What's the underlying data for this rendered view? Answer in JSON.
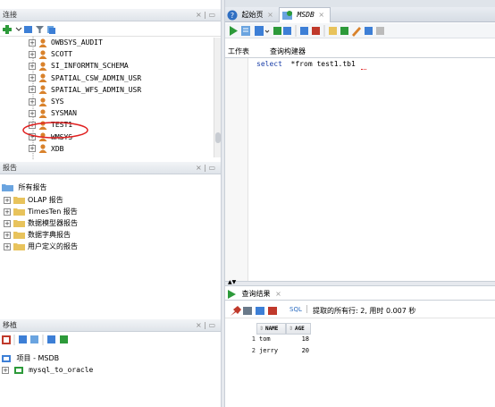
{
  "connections_panel": {
    "title": "连接",
    "controls": "× | ▭",
    "tree_items": [
      "OWBSYS_AUDIT",
      "SCOTT",
      "SI_INFORMTN_SCHEMA",
      "SPATIAL_CSW_ADMIN_USR",
      "SPATIAL_WFS_ADMIN_USR",
      "SYS",
      "SYSMAN",
      "TEST1",
      "WMSYS",
      "XDB"
    ]
  },
  "reports_panel": {
    "title": "报告",
    "controls": "× | ▭",
    "root": "所有报告",
    "items": [
      "OLAP 报告",
      "TimesTen 报告",
      "数据模型器报告",
      "数据字典报告",
      "用户定义的报告"
    ]
  },
  "migration_panel": {
    "title": "移植",
    "controls": "× | ▭",
    "project": "项目 - MSDB",
    "child": "mysql_to_oracle"
  },
  "editor_tabs": [
    {
      "label": "起始页"
    },
    {
      "label": "MSDB"
    }
  ],
  "editor": {
    "subtab_worksheet": "工作表",
    "subtab_query_builder": "查询构建器",
    "sql_keyword": "select",
    "sql_rest": "*from test1.tb1"
  },
  "results": {
    "tab_label": "查询结果",
    "sql_label": "SQL",
    "status": "提取的所有行: 2, 用时 0.007 秒",
    "columns": [
      "NAME",
      "AGE"
    ],
    "rows": [
      {
        "num": "1",
        "name": "tom",
        "age": "18"
      },
      {
        "num": "2",
        "name": "jerry",
        "age": "20"
      }
    ]
  },
  "colors": {
    "accent": "#2f6fc2",
    "user_icon": "#d9822b",
    "folder": "#e8c35c",
    "highlight_circle": "#e02020",
    "keyword": "#1b3fa8"
  }
}
